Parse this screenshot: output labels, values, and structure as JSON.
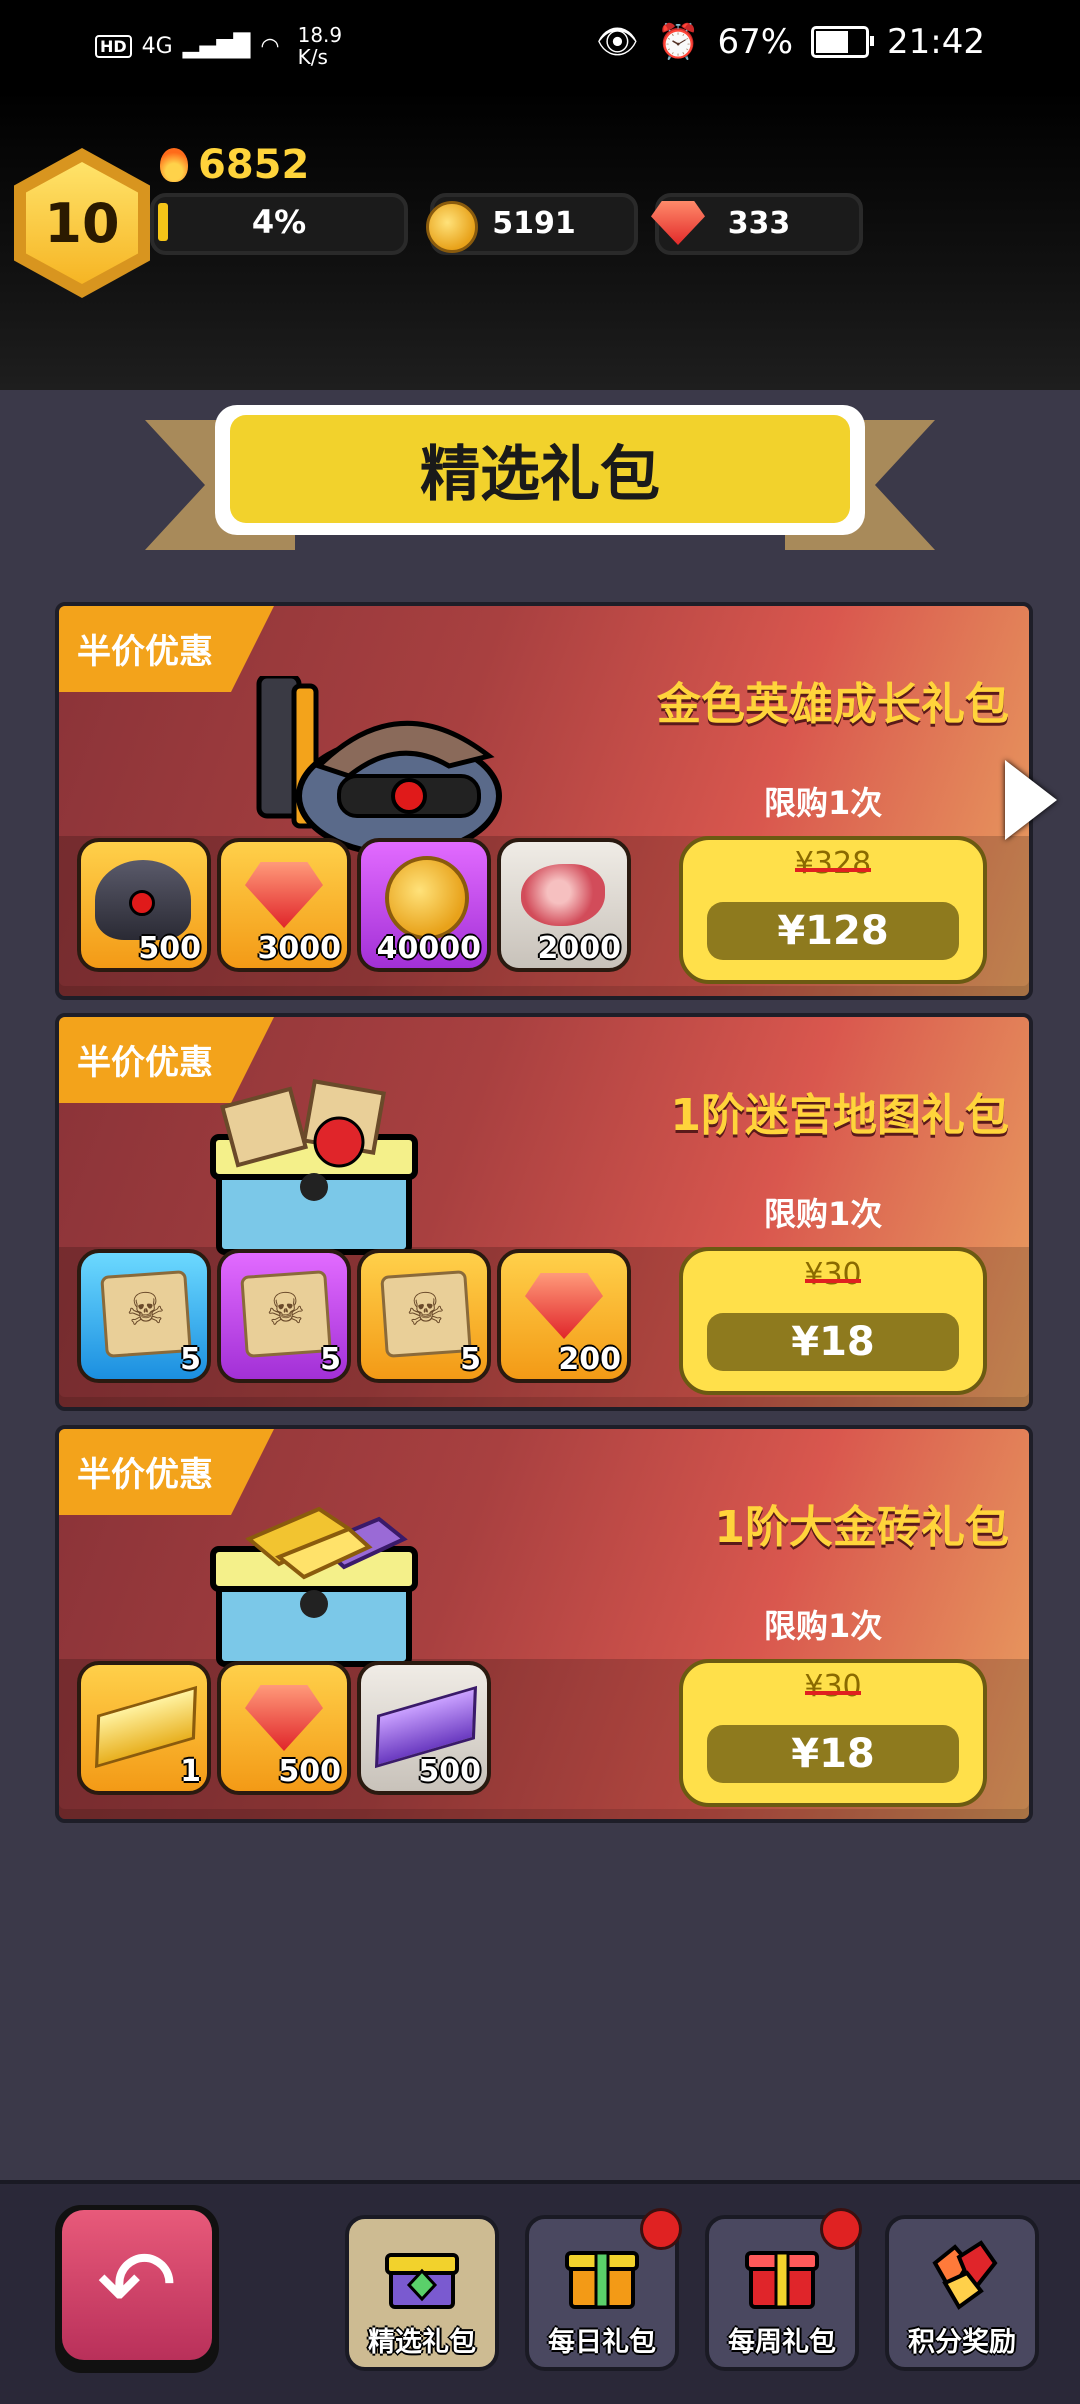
{
  "status_bar": {
    "network_hd": "HD",
    "network_type": "4G",
    "speed_value": "18.9",
    "speed_unit": "K/s",
    "battery": "67%",
    "time": "21:42"
  },
  "player": {
    "level": "10",
    "power": "6852",
    "xp_percent_label": "4%",
    "xp_fraction": 0.04,
    "coins": "5191",
    "gems": "333"
  },
  "banner": {
    "title": "精选礼包"
  },
  "packs": [
    {
      "badge": "半价优惠",
      "title": "金色英雄成长礼包",
      "limit": "限购1次",
      "old_price": "¥328",
      "price": "¥128",
      "items": [
        {
          "icon": "hero-helmet-icon",
          "count": "500",
          "color": "orange"
        },
        {
          "icon": "ruby-gem-icon",
          "count": "3000",
          "color": "orange"
        },
        {
          "icon": "gold-coin-icon",
          "count": "40000",
          "color": "purple"
        },
        {
          "icon": "meat-icon",
          "count": "2000",
          "color": "grey"
        }
      ]
    },
    {
      "badge": "半价优惠",
      "title": "1阶迷宫地图礼包",
      "limit": "限购1次",
      "old_price": "¥30",
      "price": "¥18",
      "items": [
        {
          "icon": "skull-map-icon",
          "count": "5",
          "color": "blue"
        },
        {
          "icon": "skull-map-icon",
          "count": "5",
          "color": "purple"
        },
        {
          "icon": "skull-map-icon",
          "count": "5",
          "color": "orange"
        },
        {
          "icon": "ruby-gem-icon",
          "count": "200",
          "color": "orange"
        }
      ]
    },
    {
      "badge": "半价优惠",
      "title": "1阶大金砖礼包",
      "limit": "限购1次",
      "old_price": "¥30",
      "price": "¥18",
      "items": [
        {
          "icon": "gold-bar-icon",
          "count": "1",
          "color": "orange"
        },
        {
          "icon": "ruby-gem-icon",
          "count": "500",
          "color": "orange"
        },
        {
          "icon": "purple-ingot-icon",
          "count": "500",
          "color": "grey"
        }
      ]
    }
  ],
  "bottom_nav": {
    "tabs": [
      {
        "label": "精选礼包",
        "active": true,
        "notification": false
      },
      {
        "label": "每日礼包",
        "active": false,
        "notification": true
      },
      {
        "label": "每周礼包",
        "active": false,
        "notification": true
      },
      {
        "label": "积分奖励",
        "active": false,
        "notification": false
      }
    ]
  },
  "colors": {
    "accent_yellow": "#ffd43b",
    "card_red": "#a84040",
    "badge_orange": "#f3a31b",
    "background": "#3b3949"
  }
}
